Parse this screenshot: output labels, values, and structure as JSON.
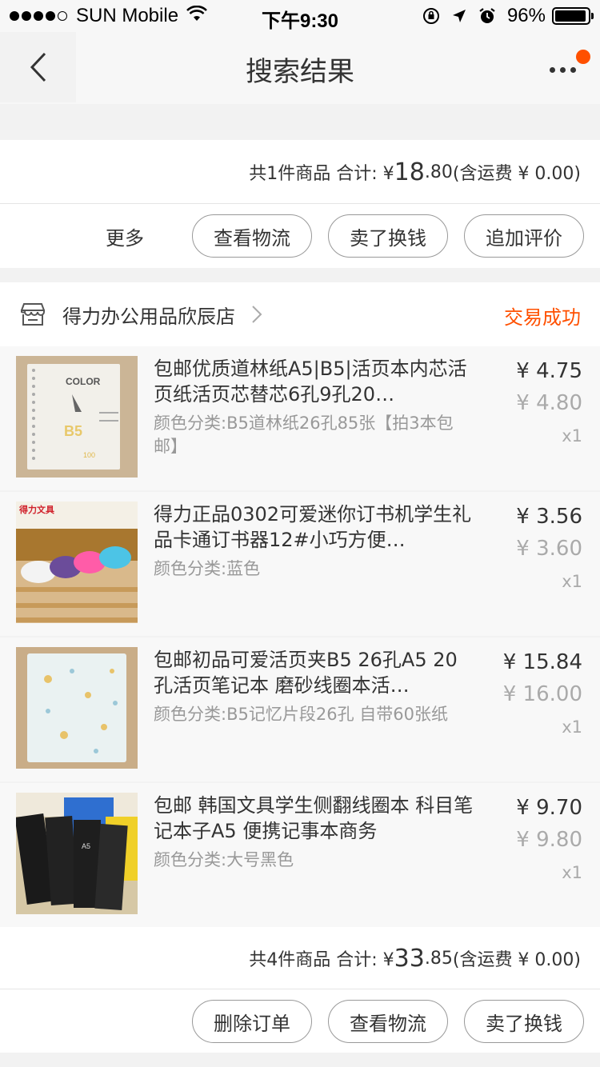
{
  "status_bar": {
    "carrier": "SUN Mobile",
    "time": "下午9:30",
    "battery": "96%",
    "battery_level": 0.96
  },
  "nav": {
    "title": "搜索结果"
  },
  "order1": {
    "summary_prefix": "共1件商品 合计: ¥ ",
    "total_int": "18",
    "total_dec": ".80",
    "shipping": " (含运费 ¥ 0.00)",
    "more_label": "更多",
    "buttons": [
      "查看物流",
      "卖了换钱",
      "追加评价"
    ]
  },
  "order2": {
    "store_name": "得力办公用品欣辰店",
    "status": "交易成功",
    "items": [
      {
        "title": "包邮优质道林纸A5|B5|活页本内芯活页纸活页芯替芯6孔9孔20…",
        "spec": "颜色分类:B5道林纸26孔85张【拍3本包邮】",
        "price": "¥ 4.75",
        "orig_price": "¥ 4.80",
        "qty": "x1",
        "thumb_text": "COLOR",
        "thumb_b5": "B5",
        "thumb_100": "100"
      },
      {
        "title": "得力正品0302可爱迷你订书机学生礼品卡通订书器12#小巧方便…",
        "spec": "颜色分类:蓝色",
        "price": "¥ 3.56",
        "orig_price": "¥ 3.60",
        "qty": "x1",
        "thumb_text": "得力文具"
      },
      {
        "title": "包邮初品可爱活页夹B5 26孔A5 20孔活页笔记本 磨砂线圈本活…",
        "spec": "颜色分类:B5记忆片段26孔 自带60张纸",
        "price": "¥ 15.84",
        "orig_price": "¥ 16.00",
        "qty": "x1"
      },
      {
        "title": "包邮 韩国文具学生侧翻线圈本 科目笔记本子A5 便携记事本商务",
        "spec": "颜色分类:大号黑色",
        "price": "¥ 9.70",
        "orig_price": "¥ 9.80",
        "qty": "x1",
        "thumb_text": "A5"
      }
    ],
    "summary_prefix": "共4件商品 合计: ¥ ",
    "total_int": "33",
    "total_dec": ".85",
    "shipping": " (含运费 ¥ 0.00)",
    "buttons": [
      "删除订单",
      "查看物流",
      "卖了换钱"
    ]
  },
  "colors": {
    "accent": "#ff5000",
    "page_bg": "#f2f2f2",
    "item_bg": "#f8f8f8"
  },
  "icons": [
    "back-icon",
    "more-icon",
    "store-icon",
    "chevron-right-icon",
    "wifi-icon",
    "location-icon",
    "alarm-icon",
    "rotation-lock-icon"
  ]
}
